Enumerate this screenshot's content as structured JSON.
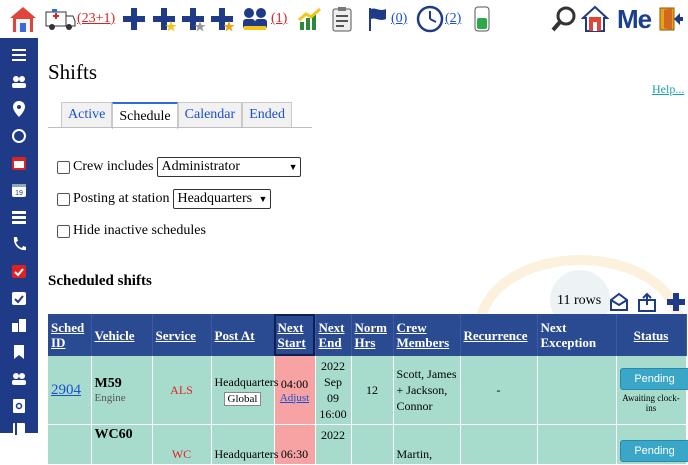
{
  "toolbar": {
    "ambulance_count": "(23+1)",
    "crew_count": "(1)",
    "flag_count": "(0)",
    "clock_count": "(2)",
    "me_label": "Me"
  },
  "page": {
    "title": "Shifts",
    "help": "Help..."
  },
  "tabs": [
    {
      "label": "Active"
    },
    {
      "label": "Schedule"
    },
    {
      "label": "Calendar"
    },
    {
      "label": "Ended"
    }
  ],
  "filters": {
    "crew_label": "Crew includes",
    "crew_value": "Administrator",
    "posting_label": "Posting at station",
    "posting_value": "Headquarters",
    "hide_label": "Hide inactive schedules"
  },
  "section": {
    "title": "Scheduled shifts",
    "rows_label": "11 rows"
  },
  "table": {
    "headers": {
      "sched_id": "Sched ID",
      "vehicle": "Vehicle",
      "service": "Service",
      "post_at": "Post At",
      "next_start": "Next Start",
      "next_end": "Next End",
      "norm_hrs": "Norm Hrs",
      "crew": "Crew Members",
      "recurrence": "Recurrence",
      "next_exception": "Next Exception",
      "status": "Status"
    },
    "rows": [
      {
        "id": "2904",
        "vehicle": "M59",
        "vehicle_type": "Engine",
        "service": "ALS",
        "post": "Headquarters",
        "post_badge": "Global",
        "start_time": "04:00",
        "adjust": "Adjust",
        "end_year": "2022",
        "end_date": "Sep 09",
        "end_time": "16:00",
        "hrs": "12",
        "crew_1": "Scott, James",
        "crew_2": "+ Jackson,",
        "crew_3": "Connor",
        "recurrence": "-",
        "status": "Pending",
        "status_note": "Awaiting clock-ins"
      },
      {
        "id": "",
        "vehicle": "WC60",
        "vehicle_type": "",
        "service": "WC",
        "post": "Headquarters",
        "start_time": "06:30",
        "end_year": "2022",
        "crew_1": "Martin,",
        "status": "Pending"
      }
    ]
  },
  "colors": {
    "sidebar": "#1f3b88",
    "header": "#2a4a92",
    "row": "#a7dccd",
    "start_cell": "#f7a3a3",
    "pending": "#3aa6c8"
  }
}
